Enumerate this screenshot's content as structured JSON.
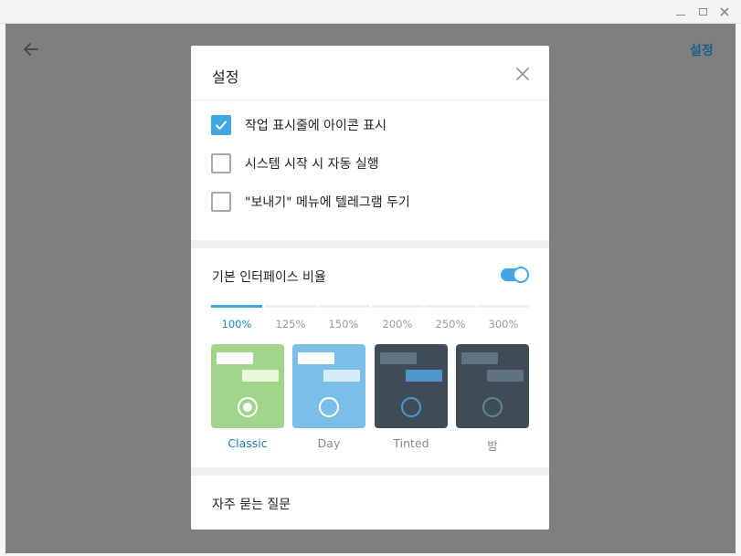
{
  "window": {
    "minimize_icon": "minimize-icon",
    "maximize_icon": "maximize-icon",
    "close_icon": "close-icon"
  },
  "header": {
    "back_icon": "back-arrow-icon",
    "settings_label": "설정"
  },
  "modal": {
    "title": "설정",
    "close_icon": "close-icon",
    "checkboxes": [
      {
        "label": "작업 표시줄에 아이콘 표시",
        "checked": true
      },
      {
        "label": "시스템 시작 시 자동 실행",
        "checked": false
      },
      {
        "label": "\"보내기\" 메뉴에 텔레그램 두기",
        "checked": false
      }
    ],
    "scale": {
      "title": "기본 인터페이스 비율",
      "toggle_on": true,
      "options": [
        "100%",
        "125%",
        "150%",
        "200%",
        "250%",
        "300%"
      ],
      "selected": "100%"
    },
    "themes": [
      {
        "name": "Classic",
        "selected": true
      },
      {
        "name": "Day",
        "selected": false
      },
      {
        "name": "Tinted",
        "selected": false
      },
      {
        "name": "밤",
        "selected": false
      }
    ],
    "faq_label": "자주 묻는 질문"
  },
  "colors": {
    "accent": "#40a7e3",
    "classic_bg": "#a1d58c",
    "day_bg": "#7bbfe8",
    "tinted_bg": "#3f4c58",
    "night_bg": "#3f4c58"
  }
}
